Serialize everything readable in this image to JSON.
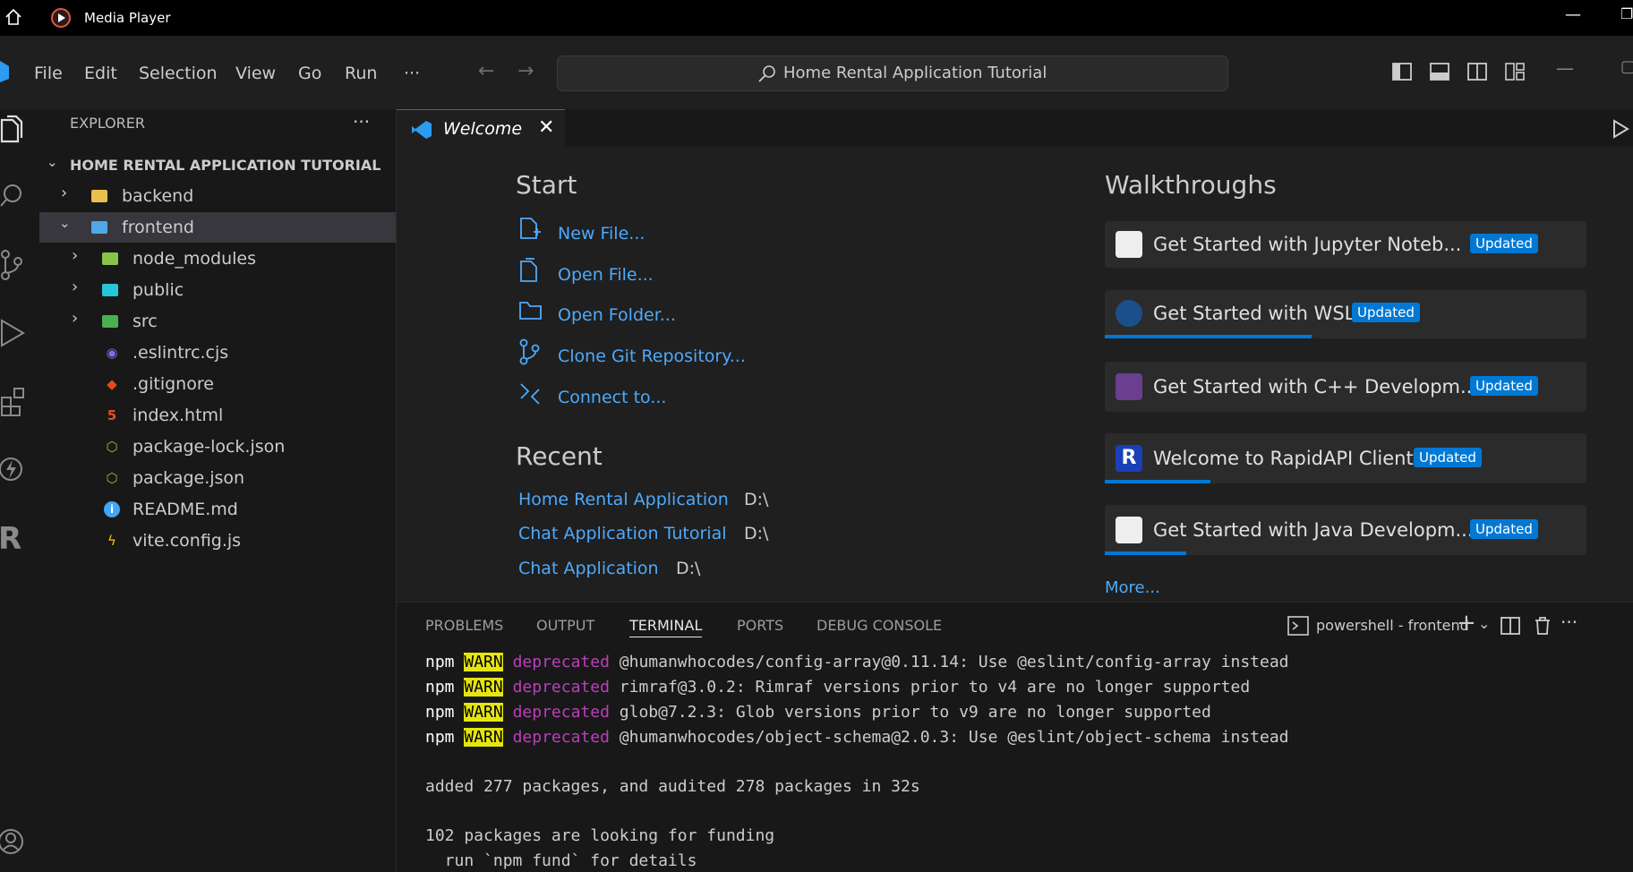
{
  "player": {
    "title": "Media Player"
  },
  "menu": {
    "items": [
      "File",
      "Edit",
      "Selection",
      "View",
      "Go",
      "Run"
    ],
    "more": "···",
    "search": "Home Rental Application Tutorial"
  },
  "explorer": {
    "header": "EXPLORER",
    "more": "···",
    "root": "HOME RENTAL APPLICATION TUTORIAL",
    "items": [
      {
        "label": "backend",
        "icon": "folder-icon"
      },
      {
        "label": "frontend",
        "icon": "folder-open-icon"
      },
      {
        "label": "node_modules",
        "icon": "folder-icon"
      },
      {
        "label": "public",
        "icon": "folder-icon"
      },
      {
        "label": "src",
        "icon": "folder-icon"
      },
      {
        "label": ".eslintrc.cjs",
        "icon": "eslint-icon"
      },
      {
        "label": ".gitignore",
        "icon": "git-icon"
      },
      {
        "label": "index.html",
        "icon": "html-icon"
      },
      {
        "label": "package-lock.json",
        "icon": "node-icon"
      },
      {
        "label": "package.json",
        "icon": "node-icon"
      },
      {
        "label": "README.md",
        "icon": "info-icon"
      },
      {
        "label": "vite.config.js",
        "icon": "vite-icon"
      }
    ]
  },
  "tab": {
    "label": "Welcome"
  },
  "welcome": {
    "start_title": "Start",
    "start": [
      "New File...",
      "Open File...",
      "Open Folder...",
      "Clone Git Repository...",
      "Connect to..."
    ],
    "recent_title": "Recent",
    "recent": [
      {
        "name": "Home Rental Application",
        "path": "D:\\"
      },
      {
        "name": "Chat Application Tutorial",
        "path": "D:\\"
      },
      {
        "name": "Chat Application",
        "path": "D:\\"
      }
    ],
    "walk_title": "Walkthroughs",
    "walkthroughs": [
      {
        "title": "Get Started with Jupyter Noteb...",
        "badge": "Updated",
        "progress": 0
      },
      {
        "title": "Get Started with WSL",
        "badge": "Updated",
        "progress": 0.43
      },
      {
        "title": "Get Started with C++ Developm...",
        "badge": "Updated",
        "progress": 0
      },
      {
        "title": "Welcome to RapidAPI Client",
        "badge": "Updated",
        "progress": 0.22
      },
      {
        "title": "Get Started with Java Developm...",
        "badge": "Updated",
        "progress": 0.17
      }
    ],
    "more": "More..."
  },
  "panel": {
    "tabs": [
      "PROBLEMS",
      "OUTPUT",
      "TERMINAL",
      "PORTS",
      "DEBUG CONSOLE"
    ],
    "active_tab": "TERMINAL",
    "terminal_name": "powershell - frontend",
    "lines": [
      {
        "npm": "npm",
        "warn": "WARN",
        "dep": "deprecated",
        "msg": " @humanwhocodes/config-array@0.11.14: Use @eslint/config-array instead"
      },
      {
        "npm": "npm",
        "warn": "WARN",
        "dep": "deprecated",
        "msg": " rimraf@3.0.2: Rimraf versions prior to v4 are no longer supported"
      },
      {
        "npm": "npm",
        "warn": "WARN",
        "dep": "deprecated",
        "msg": " glob@7.2.3: Glob versions prior to v9 are no longer supported"
      },
      {
        "npm": "npm",
        "warn": "WARN",
        "dep": "deprecated",
        "msg": " @humanwhocodes/object-schema@2.0.3: Use @eslint/object-schema instead"
      }
    ],
    "added": "added 277 packages, and audited 278 packages in 32s",
    "funding": "102 packages are looking for funding",
    "funding2": "  run `npm fund` for details"
  },
  "colors": {
    "accent": "#0078d4",
    "link": "#4daafc",
    "warn_bg": "#e5e510",
    "deprecated": "#bc3fbc"
  }
}
